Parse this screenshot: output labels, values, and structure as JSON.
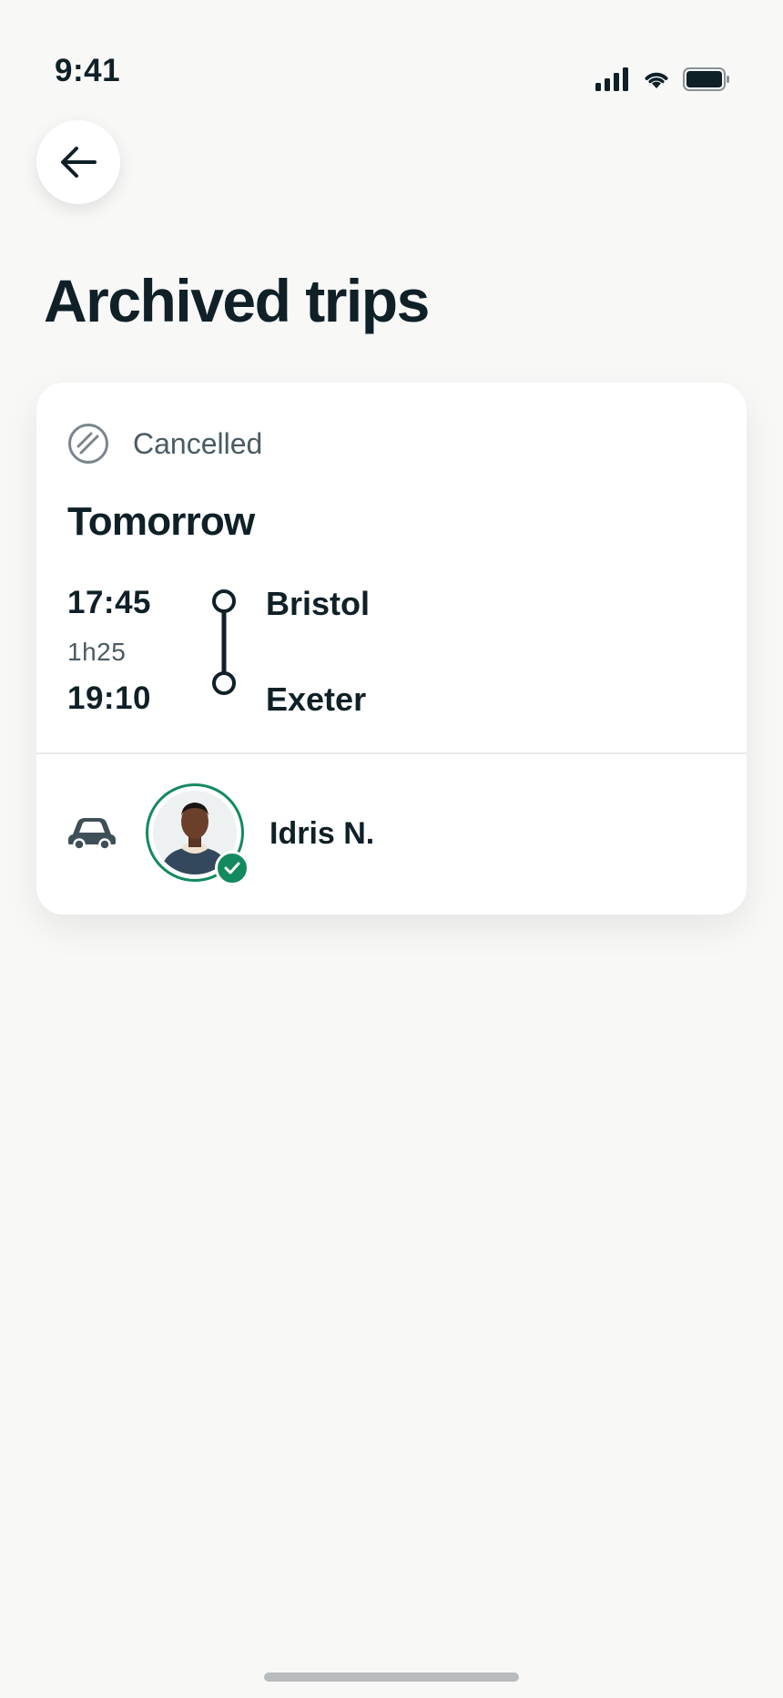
{
  "status_bar": {
    "time": "9:41",
    "icons": [
      "signal-icon",
      "wifi-icon",
      "battery-icon"
    ]
  },
  "header": {
    "back_icon": "arrow-left-icon",
    "title": "Archived trips"
  },
  "trip": {
    "status": "Cancelled",
    "status_icon": "cancelled-icon",
    "day": "Tomorrow",
    "departure_time": "17:45",
    "duration": "1h25",
    "arrival_time": "19:10",
    "origin": "Bristol",
    "destination": "Exeter",
    "vehicle_icon": "car-icon",
    "driver": {
      "name": "Idris N.",
      "verified": true
    }
  },
  "colors": {
    "background": "#f8f8f7",
    "text_primary": "#0f2027",
    "text_secondary": "#4a5b63",
    "verified_green": "#138a5e"
  }
}
